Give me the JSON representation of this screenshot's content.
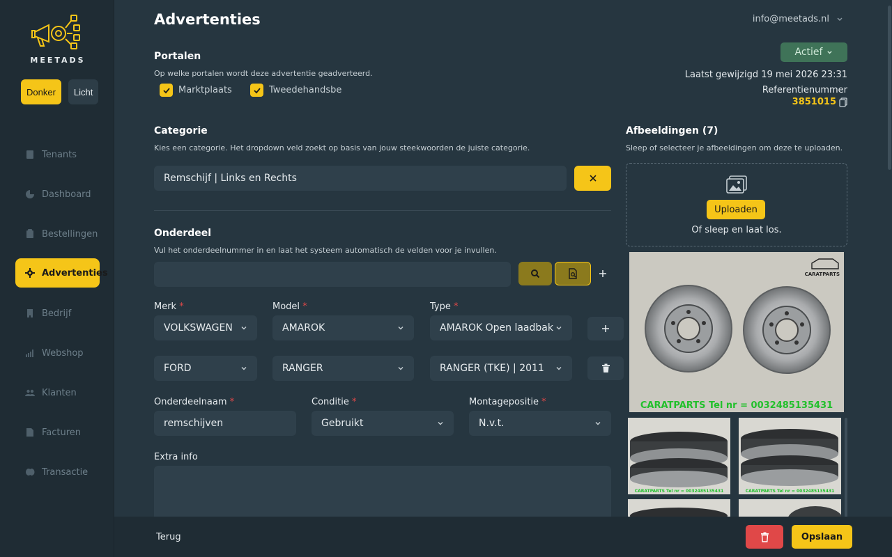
{
  "brand": {
    "logo_text": "MEETADS"
  },
  "theme": {
    "dark_label": "Donker",
    "light_label": "Licht"
  },
  "nav": [
    {
      "label": "Tenants",
      "icon": "building-icon"
    },
    {
      "label": "Dashboard",
      "icon": "pie-chart-icon"
    },
    {
      "label": "Bestellingen",
      "icon": "clipboard-icon"
    },
    {
      "label": "Advertenties",
      "icon": "gear-icon",
      "active": true
    },
    {
      "label": "Bedrijf",
      "icon": "company-icon"
    },
    {
      "label": "Webshop",
      "icon": "bar-chart-icon"
    },
    {
      "label": "Klanten",
      "icon": "users-icon"
    },
    {
      "label": "Facturen",
      "icon": "invoice-icon"
    },
    {
      "label": "Transactie",
      "icon": "coins-icon"
    }
  ],
  "header": {
    "title": "Advertenties",
    "account": "info@meetads.nl",
    "status": "Actief",
    "modified": "Laatst gewijzigd 19 mei 2026 23:31",
    "ref_label": "Referentienummer",
    "ref_value": "3851015"
  },
  "portals": {
    "title": "Portalen",
    "hint": "Op welke portalen wordt deze advertentie geadverteerd.",
    "options": [
      {
        "label": "Marktplaats",
        "checked": true
      },
      {
        "label": "Tweedehandsbe",
        "checked": true
      }
    ]
  },
  "category": {
    "title": "Categorie",
    "hint": "Kies een categorie. Het dropdown veld zoekt op basis van jouw steekwoorden de juiste categorie.",
    "value": "Remschijf | Links en Rechts"
  },
  "part": {
    "title": "Onderdeel",
    "hint": "Vul het onderdeelnummer in en laat het systeem automatisch de velden voor je invullen.",
    "number_value": ""
  },
  "vehicle": {
    "brand_label": "Merk",
    "model_label": "Model",
    "type_label": "Type",
    "rows": [
      {
        "brand": "VOLKSWAGEN",
        "model": "AMAROK",
        "type": "AMAROK Open laadbak"
      },
      {
        "brand": "FORD",
        "model": "RANGER",
        "type": "RANGER (TKE) | 2011"
      }
    ]
  },
  "details": {
    "name_label": "Onderdeelnaam",
    "name_value": "remschijven",
    "condition_label": "Conditie",
    "condition_value": "Gebruikt",
    "position_label": "Montagepositie",
    "position_value": "N.v.t.",
    "extra_label": "Extra info",
    "extra_value": ""
  },
  "images": {
    "title": "Afbeeldingen (7)",
    "hint": "Sleep of selecteer je afbeeldingen om deze te uploaden.",
    "upload_label": "Uploaden",
    "drop_hint": "Of sleep en laat los.",
    "main_caption": "CARATPARTS Tel nr = 0032485135431",
    "main_logo": "CARATPARTS",
    "thumb_caption": "CARATPARTS Tel nr = 0032485135431"
  },
  "footer": {
    "back_label": "Terug",
    "save_label": "Opslaan"
  }
}
